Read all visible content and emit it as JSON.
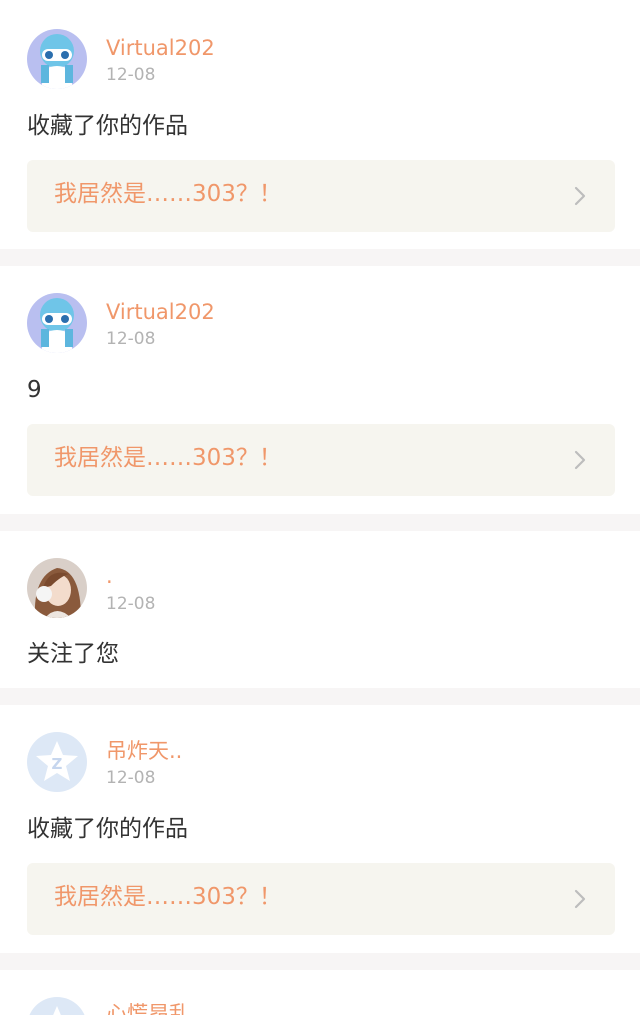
{
  "notifications": [
    {
      "username": "Virtual202",
      "time": "12-08",
      "message": "收藏了你的作品",
      "avatar_icon": "anime-character-avatar-icon",
      "work_title": "我居然是……303？！"
    },
    {
      "username": "Virtual202",
      "time": "12-08",
      "message": "9",
      "avatar_icon": "anime-character-avatar-icon",
      "work_title": "我居然是……303？！"
    },
    {
      "username": ".",
      "time": "12-08",
      "message": "关注了您",
      "avatar_icon": "photo-portrait-avatar-icon"
    },
    {
      "username": "吊炸天..",
      "time": "12-08",
      "message": "收藏了你的作品",
      "avatar_icon": "default-z-star-avatar-icon",
      "work_title": "我居然是……303？！"
    },
    {
      "username": "心慌昂乱",
      "avatar_icon": "default-z-star-avatar-icon"
    }
  ],
  "colors": {
    "accent": "#f0976a",
    "time": "#b3b3b3",
    "text": "#333333",
    "link_bg": "#f6f5ef",
    "page_bg": "#f7f5f5",
    "default_avatar": "#dde8f6"
  }
}
